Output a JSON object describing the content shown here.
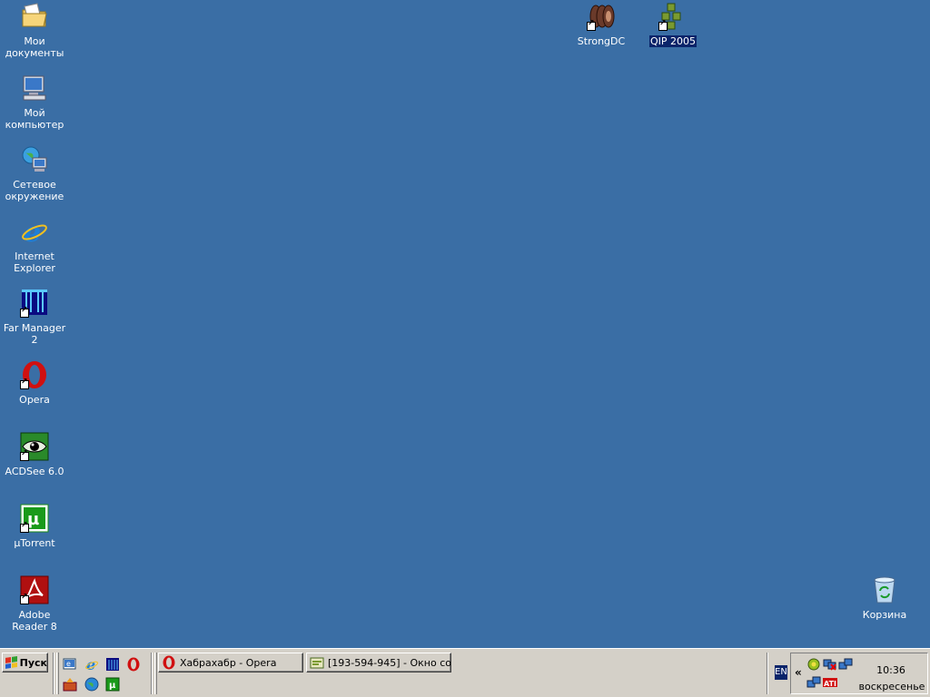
{
  "desktop": {
    "icons": [
      {
        "id": "my-documents",
        "label": "Мои документы"
      },
      {
        "id": "my-computer",
        "label": "Мой компьютер"
      },
      {
        "id": "network",
        "label": "Сетевое окружение"
      },
      {
        "id": "ie",
        "label": "Internet Explorer"
      },
      {
        "id": "far",
        "label": "Far Manager 2"
      },
      {
        "id": "opera",
        "label": "Opera"
      },
      {
        "id": "acdsee",
        "label": "ACDSee 6.0"
      },
      {
        "id": "utorrent",
        "label": "µTorrent"
      },
      {
        "id": "adobe",
        "label": "Adobe Reader 8"
      },
      {
        "id": "strongdc",
        "label": "StrongDC"
      },
      {
        "id": "qip",
        "label": "QIP 2005"
      },
      {
        "id": "recycle-bin",
        "label": "Корзина"
      }
    ]
  },
  "taskbar": {
    "start_label": "Пуск",
    "tasks": [
      {
        "label": "Хабрахабр - Opera"
      },
      {
        "label": "[193-594-945] - Окно со..."
      }
    ],
    "language": "EN",
    "tray_expand": "«",
    "clock": {
      "time": "10:36",
      "day": "воскресенье"
    }
  },
  "colors": {
    "desktop": "#3a6ea5",
    "taskbar": "#d4d0c8",
    "selection": "#0a246a"
  }
}
